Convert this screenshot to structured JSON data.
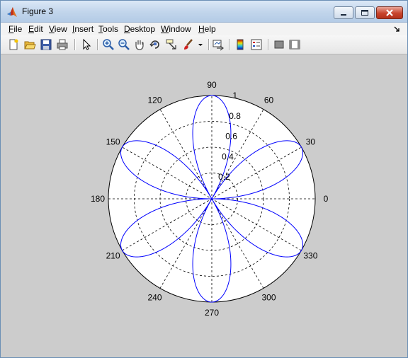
{
  "window": {
    "title": "Figure 3",
    "icon": "matlab-logo-icon"
  },
  "title_buttons": [
    "minimize-icon",
    "maximize-icon",
    "close-icon"
  ],
  "menu": {
    "items": [
      {
        "u": "F",
        "rest": "ile"
      },
      {
        "u": "E",
        "rest": "dit"
      },
      {
        "u": "V",
        "rest": "iew"
      },
      {
        "u": "I",
        "rest": "nsert"
      },
      {
        "u": "T",
        "rest": "ools"
      },
      {
        "u": "D",
        "rest": "esktop"
      },
      {
        "u": "W",
        "rest": "indow"
      },
      {
        "u": "H",
        "rest": "elp"
      }
    ]
  },
  "toolbar": {
    "icons": [
      "new-figure-icon",
      "open-file-icon",
      "save-icon",
      "print-icon",
      "edit-plot-arrow-icon",
      "zoom-in-icon",
      "zoom-out-icon",
      "pan-hand-icon",
      "rotate-3d-icon",
      "data-cursor-icon",
      "brush-icon",
      "brush-dropdown-icon",
      "link-plot-icon",
      "colorbar-icon",
      "legend-icon",
      "hide-plot-tools-icon",
      "show-plot-tools-icon"
    ]
  },
  "colors": {
    "curve": "#0000ff",
    "figure_bg": "#cccccc",
    "axes_bg": "#ffffff"
  },
  "chart_data": {
    "type": "polar",
    "function": "r = |sin(3θ)|",
    "rlim": [
      0,
      1
    ],
    "r_ticks": [
      "0.2",
      "0.4",
      "0.6",
      "0.8",
      "1"
    ],
    "theta_ticks": [
      "0",
      "30",
      "60",
      "90",
      "120",
      "150",
      "180",
      "210",
      "240",
      "270",
      "300",
      "330"
    ],
    "series": [
      {
        "petal_peaks_deg": [
          30,
          150,
          270
        ],
        "peak_r": 1
      }
    ],
    "grid": true
  }
}
